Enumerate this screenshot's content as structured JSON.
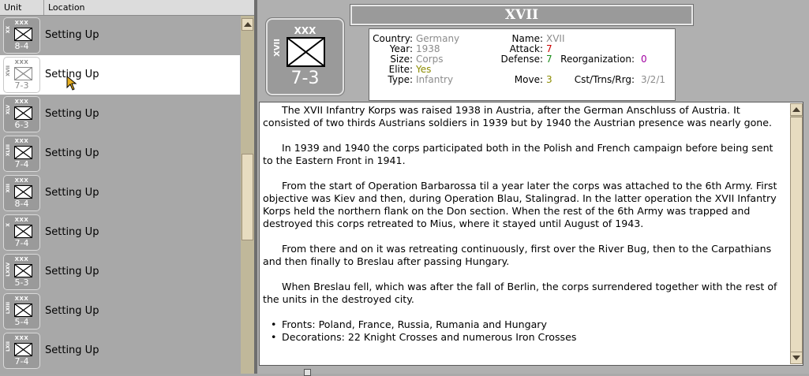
{
  "list": {
    "columns": [
      "Unit",
      "Location"
    ],
    "units": [
      {
        "size": "XXX",
        "corps": "XX",
        "strength": "8-4",
        "location": "Setting Up",
        "selected": false
      },
      {
        "size": "XXX",
        "corps": "XVII",
        "strength": "7-3",
        "location": "Setting Up",
        "selected": true
      },
      {
        "size": "XXX",
        "corps": "XLV",
        "strength": "6-3",
        "location": "Setting Up",
        "selected": false
      },
      {
        "size": "XXX",
        "corps": "XLIII",
        "strength": "7-4",
        "location": "Setting Up",
        "selected": false
      },
      {
        "size": "XXX",
        "corps": "XIII",
        "strength": "8-4",
        "location": "Setting Up",
        "selected": false
      },
      {
        "size": "XXX",
        "corps": "X",
        "strength": "7-4",
        "location": "Setting Up",
        "selected": false
      },
      {
        "size": "XXX",
        "corps": "LXXV",
        "strength": "5-3",
        "location": "Setting Up",
        "selected": false
      },
      {
        "size": "XXX",
        "corps": "LXIII",
        "strength": "5-4",
        "location": "Setting Up",
        "selected": false
      },
      {
        "size": "XXX",
        "corps": "LXII",
        "strength": "7-4",
        "location": "Setting Up",
        "selected": false
      }
    ]
  },
  "detail": {
    "title": "XVII",
    "counter": {
      "size": "XXX",
      "corps": "XVII",
      "strength": "7-3"
    },
    "info": {
      "country_label": "Country:",
      "country": "Germany",
      "year_label": "Year:",
      "year": "1938",
      "size_label": "Size:",
      "size": "Corps",
      "elite_label": "Elite:",
      "elite": "Yes",
      "type_label": "Type:",
      "type": "Infantry",
      "name_label": "Name:",
      "name": "XVII",
      "attack_label": "Attack:",
      "attack": "7",
      "defense_label": "Defense:",
      "defense": "7",
      "reorg_label": "Reorganization:",
      "reorg": "0",
      "move_label": "Move:",
      "move": "3",
      "cst_label": "Cst/Trns/Rrg:",
      "cst": "3/2/1"
    },
    "description": {
      "paragraphs": [
        "The XVII Infantry Korps was raised 1938 in Austria, after the German Anschluss of Austria.  It consisted of two thirds Austrians soldiers in 1939 but by 1940 the Austrian presence was nearly gone.",
        "In 1939 and 1940 the corps participated both in the Polish and French campaign before being sent to the Eastern Front in 1941.",
        "From the start of Operation Barbarossa til a year later the corps was attached to the 6th Army.  First objective was Kiev and then, during Operation Blau, Stalingrad.  In the latter operation the XVII Infantry Korps held the northern flank on the Don section.  When the rest of the 6th Army was trapped and destroyed this corps retreated to Mius, where it stayed until August of 1943.",
        "From there and on it was retreating continuously, first over the River Bug, then to the Carpathians and then finally to Breslau after passing Hungary.",
        "When Breslau fell, which was after the fall of Berlin, the corps surrendered together with the rest of the units in the destroyed city."
      ],
      "bullets": [
        "Fronts: Poland, France, Russia, Rumania and Hungary",
        "Decorations: 22 Knight Crosses and numerous Iron Crosses"
      ]
    }
  },
  "colors": {
    "panel": "#a8a8a8",
    "selected_row": "#ffffff",
    "scrollbar": "#c0b89a",
    "attack": "#cc0000",
    "defense": "#1a8c1a",
    "reorg": "#a000a0"
  }
}
